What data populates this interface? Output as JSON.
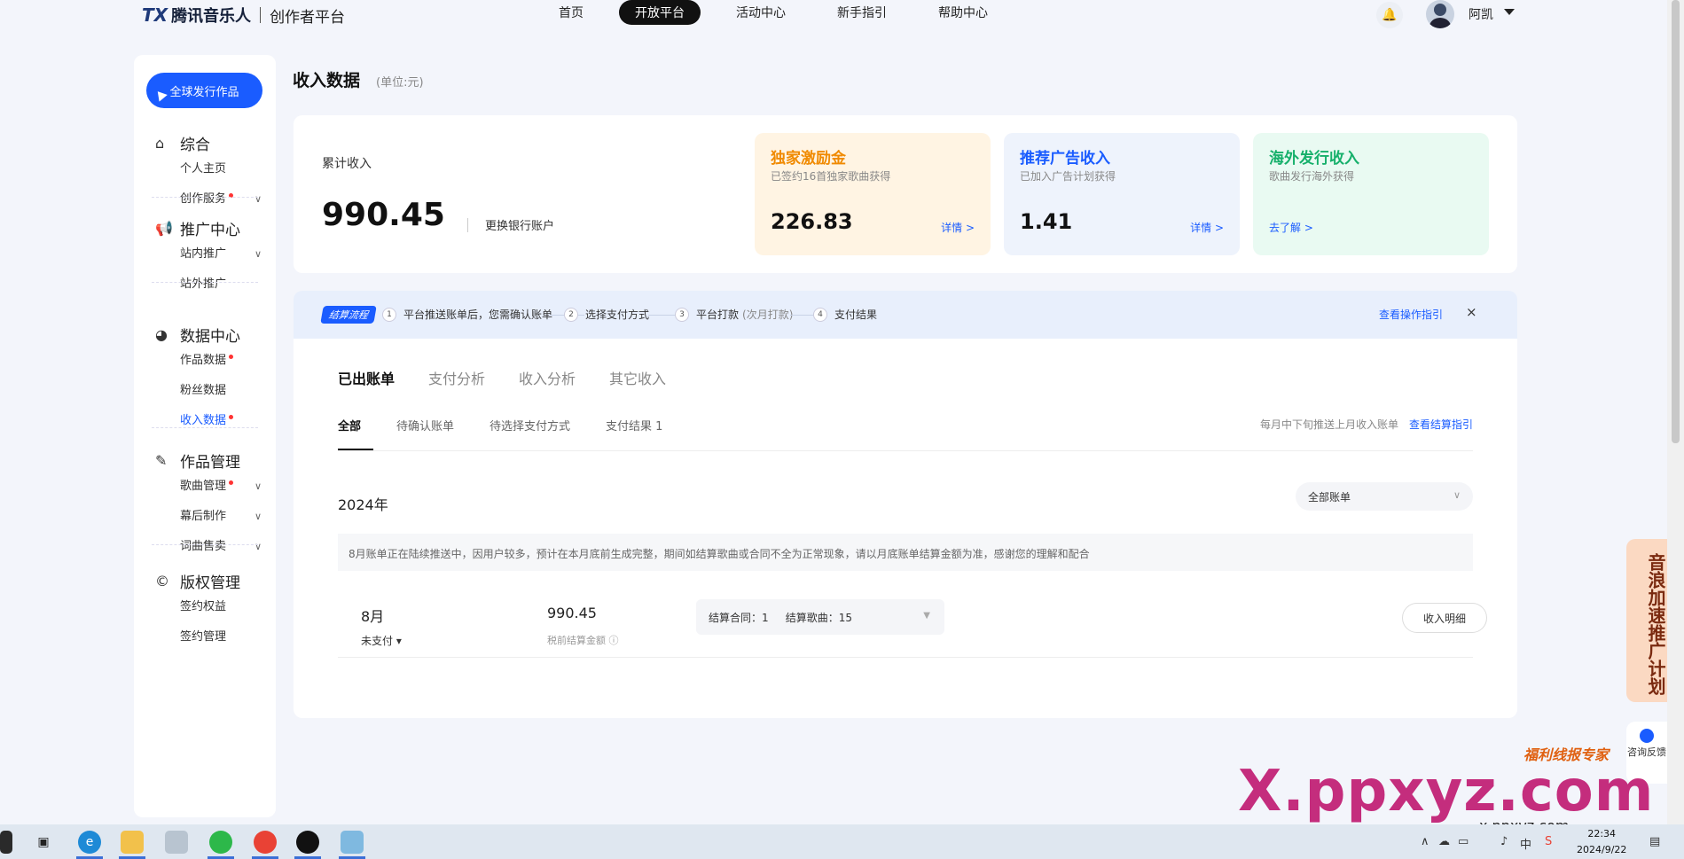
{
  "header": {
    "brand": "腾讯音乐人",
    "logo_mark": "TX",
    "subtitle": "创作者平台",
    "nav": [
      "首页",
      "开放平台",
      "活动中心",
      "新手指引",
      "帮助中心"
    ],
    "active_nav": "开放平台",
    "username": "阿凯"
  },
  "sidebar": {
    "publish_button": "全球发行作品",
    "groups": [
      {
        "title": "综合",
        "items": [
          {
            "label": "个人主页"
          },
          {
            "label": "创作服务",
            "dot": true,
            "chevron": true
          }
        ]
      },
      {
        "title": "推广中心",
        "items": [
          {
            "label": "站内推广",
            "chevron": true
          },
          {
            "label": "站外推广"
          }
        ]
      },
      {
        "title": "数据中心",
        "items": [
          {
            "label": "作品数据",
            "dot": true
          },
          {
            "label": "粉丝数据"
          },
          {
            "label": "收入数据",
            "dot": true,
            "active": true
          }
        ]
      },
      {
        "title": "作品管理",
        "items": [
          {
            "label": "歌曲管理",
            "dot": true,
            "chevron": true
          },
          {
            "label": "幕后制作",
            "chevron": true
          },
          {
            "label": "词曲售卖",
            "chevron": true
          }
        ]
      },
      {
        "title": "版权管理",
        "items": [
          {
            "label": "签约权益"
          },
          {
            "label": "签约管理"
          }
        ]
      }
    ]
  },
  "page": {
    "title": "收入数据",
    "unit": "(单位:元)"
  },
  "summary": {
    "label": "累计收入",
    "value": "990.45",
    "link": "更换银行账户",
    "cards": [
      {
        "title": "独家激励金",
        "subtitle": "已签约16首独家歌曲获得",
        "value": "226.83",
        "link": "详情 >"
      },
      {
        "title": "推荐广告收入",
        "subtitle": "已加入广告计划获得",
        "value": "1.41",
        "link": "详情 >"
      },
      {
        "title": "海外发行收入",
        "subtitle": "歌曲发行海外获得",
        "value": "",
        "link": "去了解 >"
      }
    ]
  },
  "flow": {
    "tag": "结算流程",
    "steps": [
      {
        "num": "1",
        "label": "平台推送账单后，您需确认账单",
        "sub": ""
      },
      {
        "num": "2",
        "label": "选择支付方式",
        "sub": ""
      },
      {
        "num": "3",
        "label": "平台打款",
        "sub": "(次月打款)"
      },
      {
        "num": "4",
        "label": "支付结果",
        "sub": ""
      }
    ],
    "guide_link": "查看操作指引",
    "close": "×"
  },
  "tabs": {
    "primary": [
      "已出账单",
      "支付分析",
      "收入分析",
      "其它收入"
    ],
    "secondary": [
      "全部",
      "待确认账单",
      "待选择支付方式",
      "支付结果 1"
    ],
    "note": "每月中下旬推送上月收入账单",
    "note_link": "查看结算指引"
  },
  "bills": {
    "year": "2024年",
    "filter": "全部账单",
    "notice": "8月账单正在陆续推送中，因用户较多，预计在本月底前生成完整，期间如结算歌曲或合同不全为正常现象，请以月底账单结算金额为准，感谢您的理解和配合",
    "rows": [
      {
        "month": "8月",
        "status": "未支付",
        "amount": "990.45",
        "amount_label": "税前结算金额",
        "contracts": "结算合同：1",
        "songs": "结算歌曲：15",
        "button": "收入明细"
      }
    ]
  },
  "floating": {
    "promo": "音浪加速推广计划",
    "consult": "咨询反馈"
  },
  "watermark": {
    "brand": "福利线报专家",
    "site": "X.ppxyz.com",
    "site_small": "x.ppxyz.com"
  },
  "taskbar": {
    "time": "22:34",
    "date": "2024/9/22",
    "ime": "中"
  }
}
